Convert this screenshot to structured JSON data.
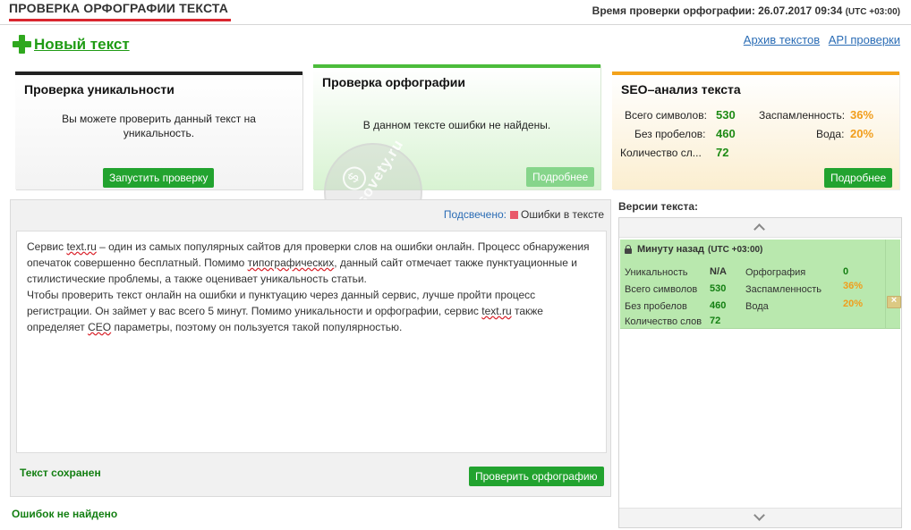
{
  "header": {
    "page_title": "ПРОВЕРКА ОРФОГРАФИИ ТЕКСТА",
    "check_time_label": "Время проверки орфографии: 26.07.2017 09:34",
    "check_time_tz": "(UTC +03:00)"
  },
  "new_text_label": "Новый текст",
  "links": {
    "archive": "Архив текстов",
    "api": "API проверки"
  },
  "cards": {
    "uniqueness": {
      "title": "Проверка уникальности",
      "body": "Вы можете проверить данный текст на уникальность.",
      "button": "Запустить проверку"
    },
    "spelling": {
      "title": "Проверка орфографии",
      "body": "В данном тексте ошибки не найдены.",
      "button": "Подробнее"
    },
    "seo": {
      "title": "SEO–анализ текста",
      "total_label": "Всего символов:",
      "total_value": "530",
      "spam_label": "Заспамленность:",
      "spam_value": "36%",
      "nospace_label": "Без пробелов:",
      "nospace_value": "460",
      "water_label": "Вода:",
      "water_value": "20%",
      "words_label": "Количество сл...",
      "words_value": "72",
      "button": "Подробнее"
    }
  },
  "editor": {
    "highlight_label": "Подсвечено:",
    "errors_legend": "Ошибки в тексте",
    "text_segments": {
      "s1": "Сервис ",
      "s2": "text.ru",
      "s3": " – один из самых популярных сайтов для проверки слов на ошибки онлайн. Процесс обнаружения опечаток совершенно бесплатный. Помимо ",
      "s4": "типографических",
      "s5": ", данный сайт отмечает также пунктуационные и стилистические проблемы, а также оценивает уникальность статьи.",
      "s6": "Чтобы проверить текст онлайн на ошибки и пунктуацию через данный сервис, лучше пройти процесс регистрации. Он займет у вас всего 5 минут. Помимо уникальности и орфографии, сервис ",
      "s7": "text.ru",
      "s8": " также определяет ",
      "s9": "СЕО",
      "s10": " параметры, поэтому он пользуется такой популярностью."
    },
    "saved_status": "Текст сохранен",
    "check_button": "Проверить орфографию"
  },
  "no_errors_status": "Ошибок не найдено",
  "versions": {
    "title": "Версии текста:",
    "items": [
      {
        "time": "Минуту назад",
        "tz": "(UTC +03:00)",
        "uniqueness_label": "Уникальность",
        "uniqueness_value": "N/A",
        "spelling_label": "Орфография",
        "spelling_value": "0",
        "total_label": "Всего символов",
        "total_value": "530",
        "spam_label": "Заспамленность",
        "spam_value": "36%",
        "nospace_label": "Без пробелов",
        "nospace_value": "460",
        "water_label": "Вода",
        "water_value": "20%",
        "words_label": "Количество слов",
        "words_value": "72"
      }
    ]
  },
  "watermark": {
    "text": "inetsovety.ru"
  },
  "colors": {
    "accent_red": "#d9262e",
    "green": "#22a32f",
    "orange": "#f19d1b",
    "link": "#2a6cb5"
  }
}
